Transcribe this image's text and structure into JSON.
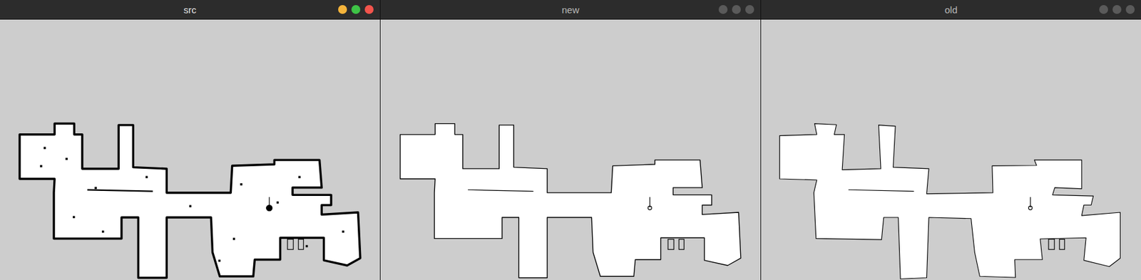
{
  "windows": [
    {
      "title": "src",
      "focused": true,
      "kind": "raw"
    },
    {
      "title": "new",
      "focused": false,
      "kind": "smooth"
    },
    {
      "title": "old",
      "focused": false,
      "kind": "jagged"
    }
  ]
}
